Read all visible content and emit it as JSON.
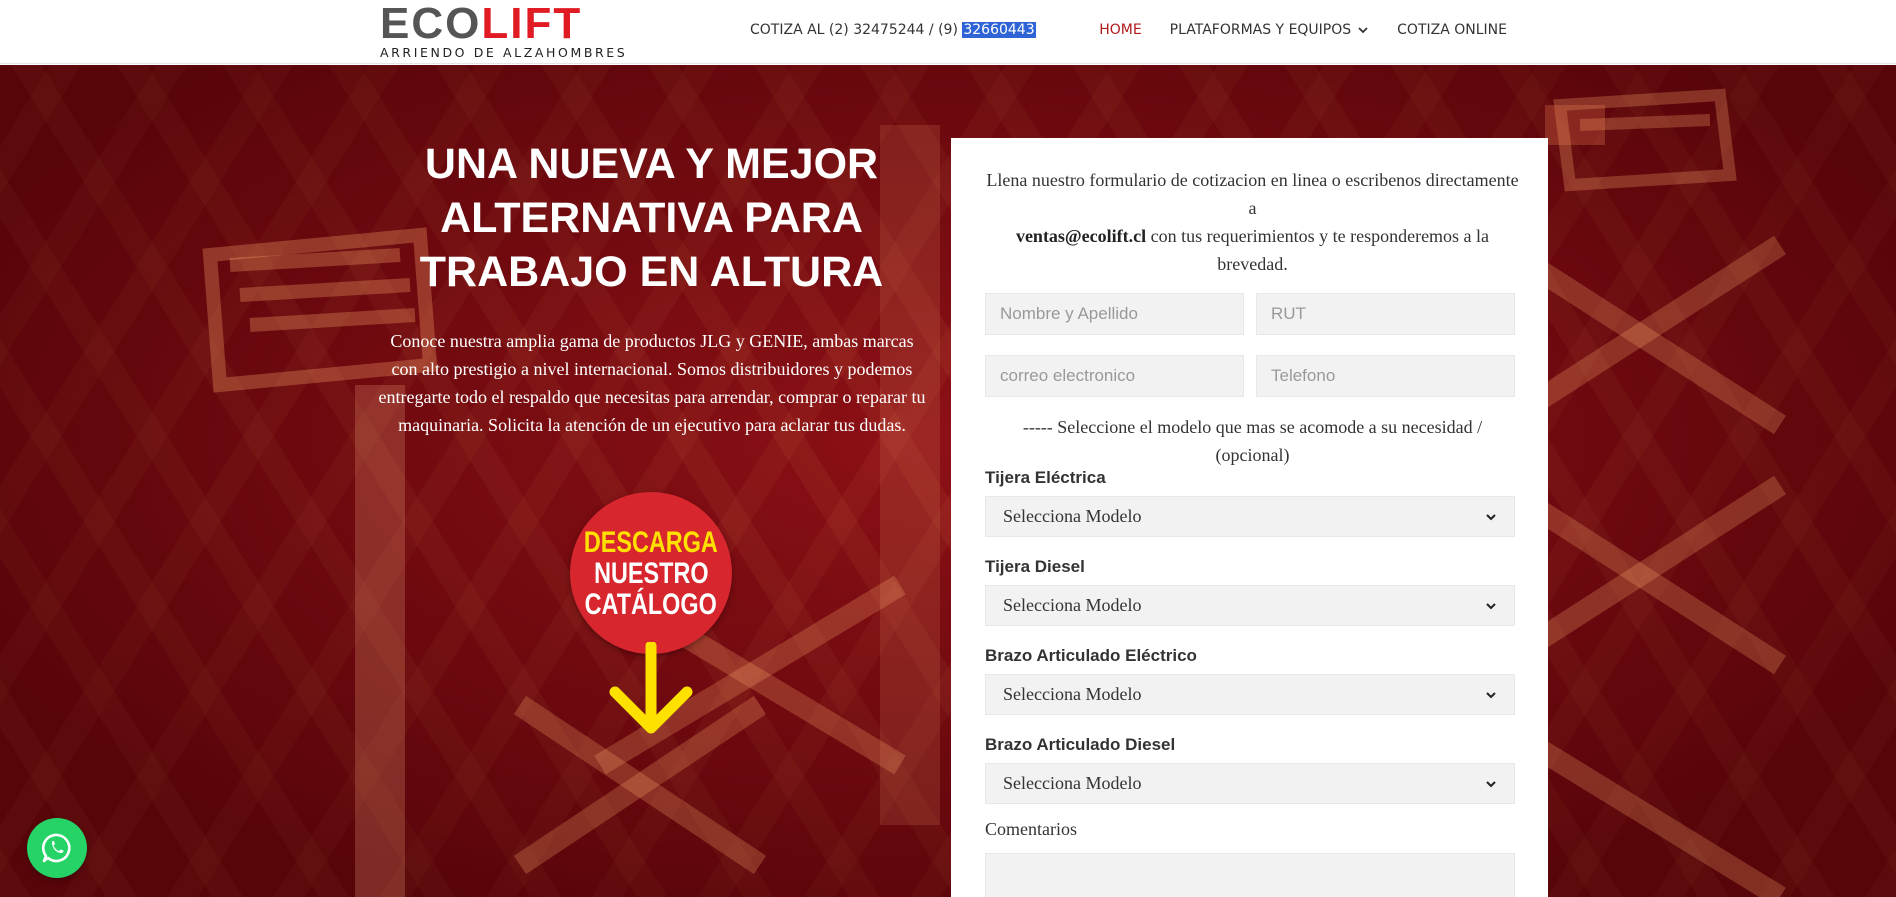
{
  "header": {
    "logo": {
      "eco": "ECO",
      "lift": "LIFT",
      "tagline": "ARRIENDO DE ALZAHOMBRES"
    },
    "quote_prefix": "COTIZA AL (2) 32475244 / (9) ",
    "quote_highlight": "32660443",
    "nav": [
      {
        "label": "HOME",
        "active": true
      },
      {
        "label": "PLATAFORMAS Y EQUIPOS",
        "has_dropdown": true,
        "icon": "chevron-down-icon"
      },
      {
        "label": "COTIZA ONLINE"
      }
    ]
  },
  "hero": {
    "title": "UNA NUEVA Y MEJOR ALTERNATIVA PARA TRABAJO EN ALTURA",
    "description": "Conoce nuestra amplia gama de productos JLG y GENIE, ambas marcas con alto prestigio a nivel internacional. Somos distribuidores y podemos entregarte todo el respaldo que necesitas para arrendar, comprar o reparar tu maquinaria. Solicita la atención de un ejecutivo para aclarar tus dudas.",
    "catalog": {
      "line1": "DESCARGA",
      "line2": "NUESTRO",
      "line3": "CATÁLOGO",
      "arrow_icon": "arrow-down-icon"
    }
  },
  "form": {
    "intro_before": "Llena nuestro formulario de cotizacion en linea o escribenos directamente a",
    "intro_email": "ventas@ecolift.cl",
    "intro_after": "con tus requerimientos y te responderemos a la brevedad.",
    "name_placeholder": "Nombre y Apellido",
    "rut_placeholder": "RUT",
    "email_placeholder": "correo electronico",
    "phone_placeholder": "Telefono",
    "model_hint": "----- Seleccione el modelo que mas se acomode a su necesidad / (opcional)",
    "groups": [
      {
        "label": "Tijera Eléctrica",
        "selected": "Selecciona Modelo"
      },
      {
        "label": "Tijera Diesel",
        "selected": "Selecciona Modelo"
      },
      {
        "label": "Brazo Articulado Eléctrico",
        "selected": "Selecciona Modelo"
      },
      {
        "label": "Brazo Articulado Diesel",
        "selected": "Selecciona Modelo"
      }
    ],
    "comments_label": "Comentarios"
  },
  "whatsapp": {
    "icon": "whatsapp-icon"
  },
  "colors": {
    "brand_red": "#e01b24",
    "nav_active": "#b11a1a",
    "highlight": "#2f64d6",
    "catalog_red": "#d8262e",
    "catalog_yellow": "#ffe100",
    "whatsapp_green": "#25d366"
  }
}
